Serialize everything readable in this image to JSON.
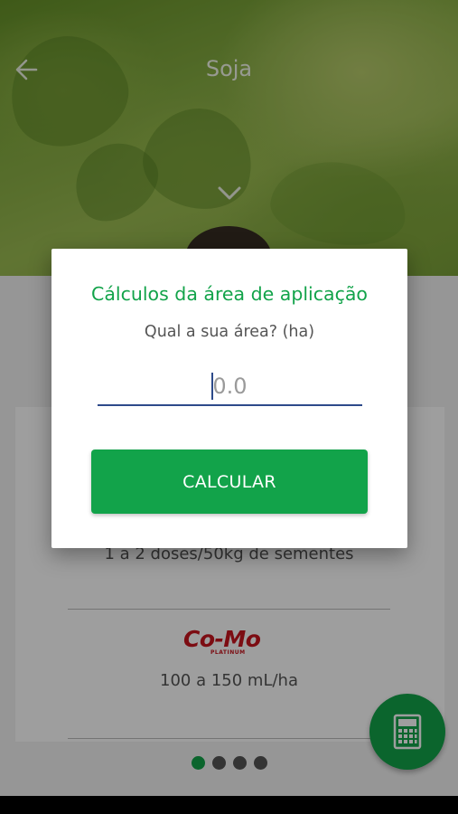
{
  "header": {
    "title": "Soja"
  },
  "content": {
    "dose_line_1": "1 a 2 doses/50kg de sementes",
    "product_logo": {
      "name": "Co-Mo",
      "subtitle": "PLATINUM"
    },
    "dose_line_2": "100 a 150 mL/ha"
  },
  "pagination": {
    "total": 4,
    "active": 1
  },
  "dialog": {
    "title": "Cálculos da área de aplicação",
    "question": "Qual a sua área? (ha)",
    "input_value": "",
    "input_placeholder": "0.0",
    "button_label": "CALCULAR"
  },
  "icons": {
    "back": "arrow-left-icon",
    "expand": "chevron-down-icon",
    "fab": "calculator-icon"
  },
  "colors": {
    "accent": "#12a34a",
    "input_underline": "#2d4a8a",
    "logo": "#c8141e"
  }
}
